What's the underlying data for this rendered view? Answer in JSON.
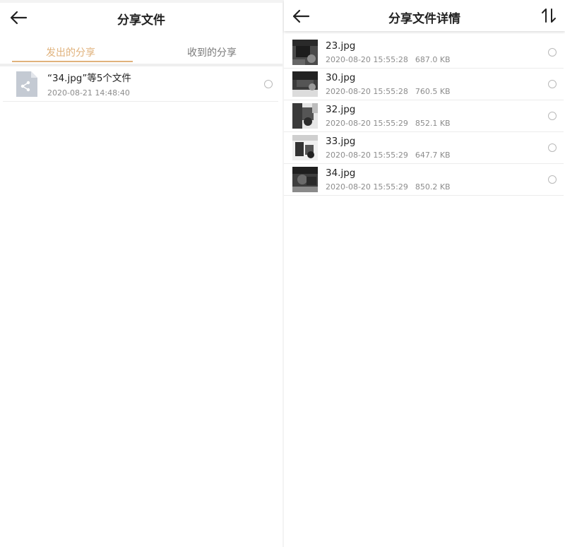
{
  "left_screen": {
    "title": "分享文件",
    "tabs": [
      {
        "label": "发出的分享",
        "active": true
      },
      {
        "label": "收到的分享",
        "active": false
      }
    ],
    "items": [
      {
        "name": "“34.jpg”等5个文件",
        "date": "2020-08-21 14:48:40",
        "icon": "share-file-icon"
      }
    ]
  },
  "right_screen": {
    "title": "分享文件详情",
    "sort_icon": "sort-arrows-icon",
    "files": [
      {
        "name": "23.jpg",
        "date": "2020-08-20 15:55:28",
        "size": "687.0 KB"
      },
      {
        "name": "30.jpg",
        "date": "2020-08-20 15:55:28",
        "size": "760.5 KB"
      },
      {
        "name": "32.jpg",
        "date": "2020-08-20 15:55:29",
        "size": "852.1 KB"
      },
      {
        "name": "33.jpg",
        "date": "2020-08-20 15:55:29",
        "size": "647.7 KB"
      },
      {
        "name": "34.jpg",
        "date": "2020-08-20 15:55:29",
        "size": "850.2 KB"
      }
    ]
  },
  "colors": {
    "accent": "#e0b27c",
    "text_primary": "#222222",
    "text_secondary": "#8c8c8c",
    "tab_inactive": "#7a7a7a",
    "divider": "#ececec",
    "icon_file": "#c4cad3"
  }
}
